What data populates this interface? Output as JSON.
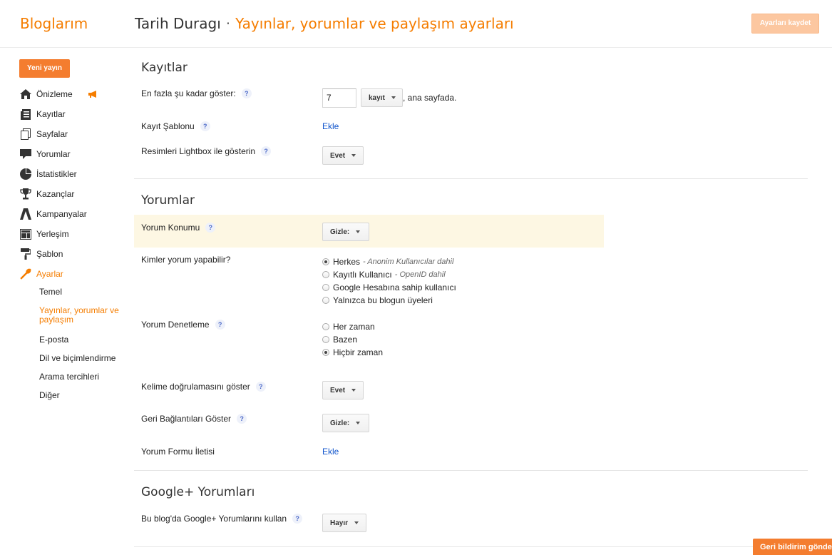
{
  "header": {
    "brand": "Bloglarım",
    "blog_name": "Tarih Duragı",
    "separator": "·",
    "section_title": "Yayınlar, yorumlar ve paylaşım ayarları",
    "save_label": "Ayarları kaydet"
  },
  "sidebar": {
    "new_post_label": "Yeni yayın",
    "items": [
      {
        "label": "Önizleme",
        "icon": "home-icon"
      },
      {
        "label": "Kayıtlar",
        "icon": "posts-icon"
      },
      {
        "label": "Sayfalar",
        "icon": "pages-icon"
      },
      {
        "label": "Yorumlar",
        "icon": "comment-icon"
      },
      {
        "label": "İstatistikler",
        "icon": "pie-chart-icon"
      },
      {
        "label": "Kazançlar",
        "icon": "trophy-icon"
      },
      {
        "label": "Kampanyalar",
        "icon": "campaign-icon"
      },
      {
        "label": "Yerleşim",
        "icon": "layout-icon"
      },
      {
        "label": "Şablon",
        "icon": "paint-roller-icon"
      },
      {
        "label": "Ayarlar",
        "icon": "wrench-icon"
      }
    ],
    "subitems": [
      "Temel",
      "Yayınlar, yorumlar ve paylaşım",
      "E-posta",
      "Dil ve biçimlendirme",
      "Arama tercihleri",
      "Diğer"
    ]
  },
  "posts": {
    "title": "Kayıtlar",
    "show_label": "En fazla şu kadar göster:",
    "show_value": "7",
    "unit_label": "kayıt",
    "suffix": ", ana sayfada.",
    "template_label": "Kayıt Şablonu",
    "template_link": "Ekle",
    "lightbox_label": "Resimleri Lightbox ile gösterin",
    "lightbox_value": "Evet"
  },
  "comments": {
    "title": "Yorumlar",
    "location_label": "Yorum Konumu",
    "location_value": "Gizle:",
    "who_label": "Kimler yorum yapabilir?",
    "who_options": [
      {
        "label": "Herkes",
        "hint": "- Anonim Kullanıcılar dahil",
        "selected": true
      },
      {
        "label": "Kayıtlı Kullanıcı",
        "hint": "- OpenID dahil",
        "selected": false
      },
      {
        "label": "Google Hesabına sahip kullanıcı",
        "hint": "",
        "selected": false
      },
      {
        "label": "Yalnızca bu blogun üyeleri",
        "hint": "",
        "selected": false
      }
    ],
    "moderation_label": "Yorum Denetleme",
    "moderation_options": [
      {
        "label": "Her zaman",
        "selected": false
      },
      {
        "label": "Bazen",
        "selected": false
      },
      {
        "label": "Hiçbir zaman",
        "selected": true
      }
    ],
    "captcha_label": "Kelime doğrulamasını göster",
    "captcha_value": "Evet",
    "backlinks_label": "Geri Bağlantıları Göster",
    "backlinks_value": "Gizle:",
    "form_msg_label": "Yorum Formu İletisi",
    "form_msg_link": "Ekle"
  },
  "gplus": {
    "title": "Google+ Yorumları",
    "use_label": "Bu blog'da Google+ Yorumlarını kullan",
    "use_value": "Hayır"
  },
  "help_glyph": "?",
  "feedback_label": "Geri bildirim gönder",
  "colors": {
    "accent": "#f57d00",
    "link": "#1155cc",
    "highlight": "#fdf7e3"
  }
}
